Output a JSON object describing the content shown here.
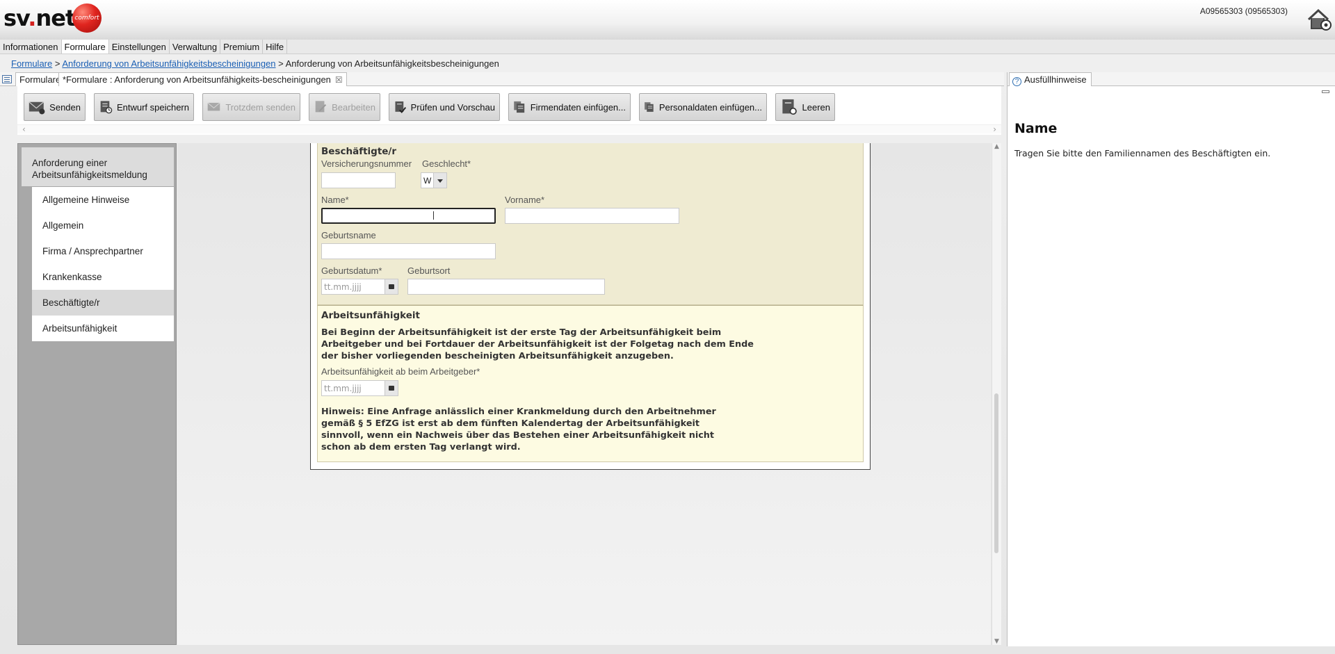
{
  "header": {
    "logo_text": "sv.net",
    "logo_badge": "comfort",
    "account": "A09565303 (09565303)"
  },
  "menu": [
    "Informationen",
    "Formulare",
    "Einstellungen",
    "Verwaltung",
    "Premium",
    "Hilfe"
  ],
  "breadcrumb": {
    "root": "Formulare",
    "sep": " > ",
    "link": "Anforderung von Arbeitsunfähigkeitsbescheinigungen",
    "current": "Anforderung von Arbeitsunfähigkeitsbescheinigungen"
  },
  "tabs": {
    "formulare": "Formulare",
    "active": "*Formulare : Anforderung von Arbeitsunfähigkeits-bescheinigungen",
    "close": "☒"
  },
  "toolbar": {
    "send": "Senden",
    "save_draft": "Entwurf speichern",
    "send_anyway": "Trotzdem senden",
    "edit": "Bearbeiten",
    "check_preview": "Prüfen und Vorschau",
    "insert_company": "Firmendaten einfügen...",
    "insert_personal": "Personaldaten einfügen...",
    "clear": "Leeren"
  },
  "nav": {
    "heading_line1": "Anforderung einer",
    "heading_line2": "Arbeitsunfähigkeitsmeldung",
    "items": [
      "Allgemeine Hinweise",
      "Allgemein",
      "Firma / Ansprechpartner",
      "Krankenkasse",
      "Beschäftigte/r",
      "Arbeitsunfähigkeit"
    ],
    "selected": "Beschäftigte/r"
  },
  "form": {
    "employee": {
      "title": "Beschäftigte/r",
      "insurance_label": "Versicherungsnummer",
      "insurance_value": "",
      "gender_label": "Geschlecht*",
      "gender_value": "W",
      "name_label": "Name*",
      "name_value": "",
      "firstname_label": "Vorname*",
      "firstname_value": "",
      "birthname_label": "Geburtsname",
      "birthname_value": "",
      "birthdate_label": "Geburtsdatum*",
      "birthdate_placeholder": "tt.mm.jjjj",
      "birthplace_label": "Geburtsort",
      "birthplace_value": ""
    },
    "incapacity": {
      "title": "Arbeitsunfähigkeit",
      "info": "Bei Beginn der Arbeitsunfähigkeit ist der erste Tag der Arbeitsunfähigkeit beim\nArbeitgeber und bei Fortdauer der Arbeitsunfähigkeit ist der Folgetag nach dem Ende\nder bisher vorliegenden bescheinigten Arbeitsunfähigkeit anzugeben.",
      "since_label": "Arbeitsunfähigkeit ab beim Arbeitgeber*",
      "since_placeholder": "tt.mm.jjjj",
      "note": "Hinweis: Eine Anfrage anlässlich einer Krankmeldung durch den Arbeitnehmer\ngemäß § 5 EfZG ist erst ab dem fünften Kalendertag der Arbeitsunfähigkeit\nsinnvoll, wenn ein Nachweis über das Bestehen einer Arbeitsunfähigkeit nicht\nschon ab dem ersten Tag verlangt wird."
    }
  },
  "hints": {
    "tab": "Ausfüllhinweise",
    "title": "Name",
    "text": "Tragen Sie bitte den Familiennamen des Beschäftigten ein."
  }
}
